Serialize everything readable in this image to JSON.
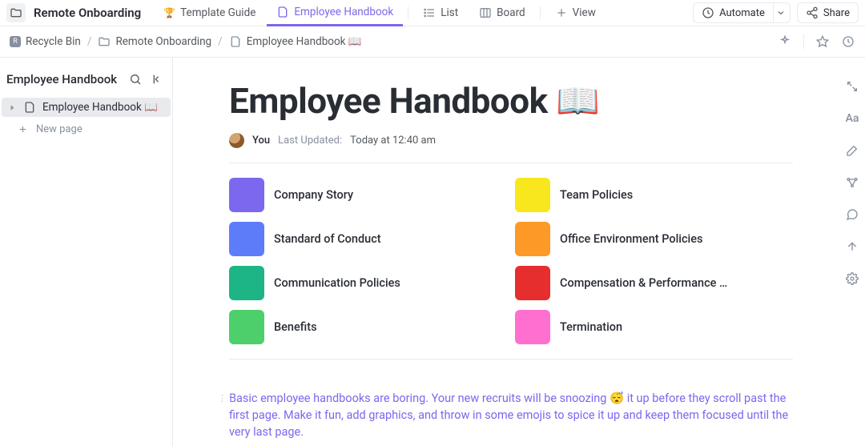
{
  "workspace_name": "Remote Onboarding",
  "tabs": [
    {
      "icon": "🏆",
      "label": "Template Guide"
    },
    {
      "icon": "doc",
      "label": "Employee Handbook"
    },
    {
      "icon": "list",
      "label": "List"
    },
    {
      "icon": "board",
      "label": "Board"
    },
    {
      "icon": "plus",
      "label": "View"
    }
  ],
  "automate_label": "Automate",
  "share_label": "Share",
  "breadcrumb": {
    "recycle_icon": "R",
    "item0": "Recycle Bin",
    "item1": "Remote Onboarding",
    "item2": "Employee Handbook 📖"
  },
  "sidebar": {
    "title": "Employee Handbook",
    "item0_label": "Employee Handbook 📖",
    "new_page_label": "New page"
  },
  "doc": {
    "title": "Employee Handbook 📖",
    "author_label": "You",
    "updated_label": "Last Updated:",
    "updated_value": "Today at 12:40 am"
  },
  "cards": [
    {
      "color": "#7b68ee",
      "label": "Company Story"
    },
    {
      "color": "#f8e71c",
      "label": "Team Policies"
    },
    {
      "color": "#5c7cfa",
      "label": "Standard of Conduct"
    },
    {
      "color": "#fd9a27",
      "label": "Office Environment Policies"
    },
    {
      "color": "#1db586",
      "label": "Communication Policies"
    },
    {
      "color": "#e62e2e",
      "label": "Compensation & Performance Re..."
    },
    {
      "color": "#4dcf6b",
      "label": "Benefits"
    },
    {
      "color": "#ff6fcf",
      "label": "Termination"
    }
  ],
  "body": "Basic employee handbooks are boring. Your new recruits will be snoozing 😴  it up before they scroll past the first page. Make it fun, add graphics, and throw in some emojis to spice it up and keep them focused until the very last page.",
  "right_rail": {
    "aa": "Aa"
  }
}
